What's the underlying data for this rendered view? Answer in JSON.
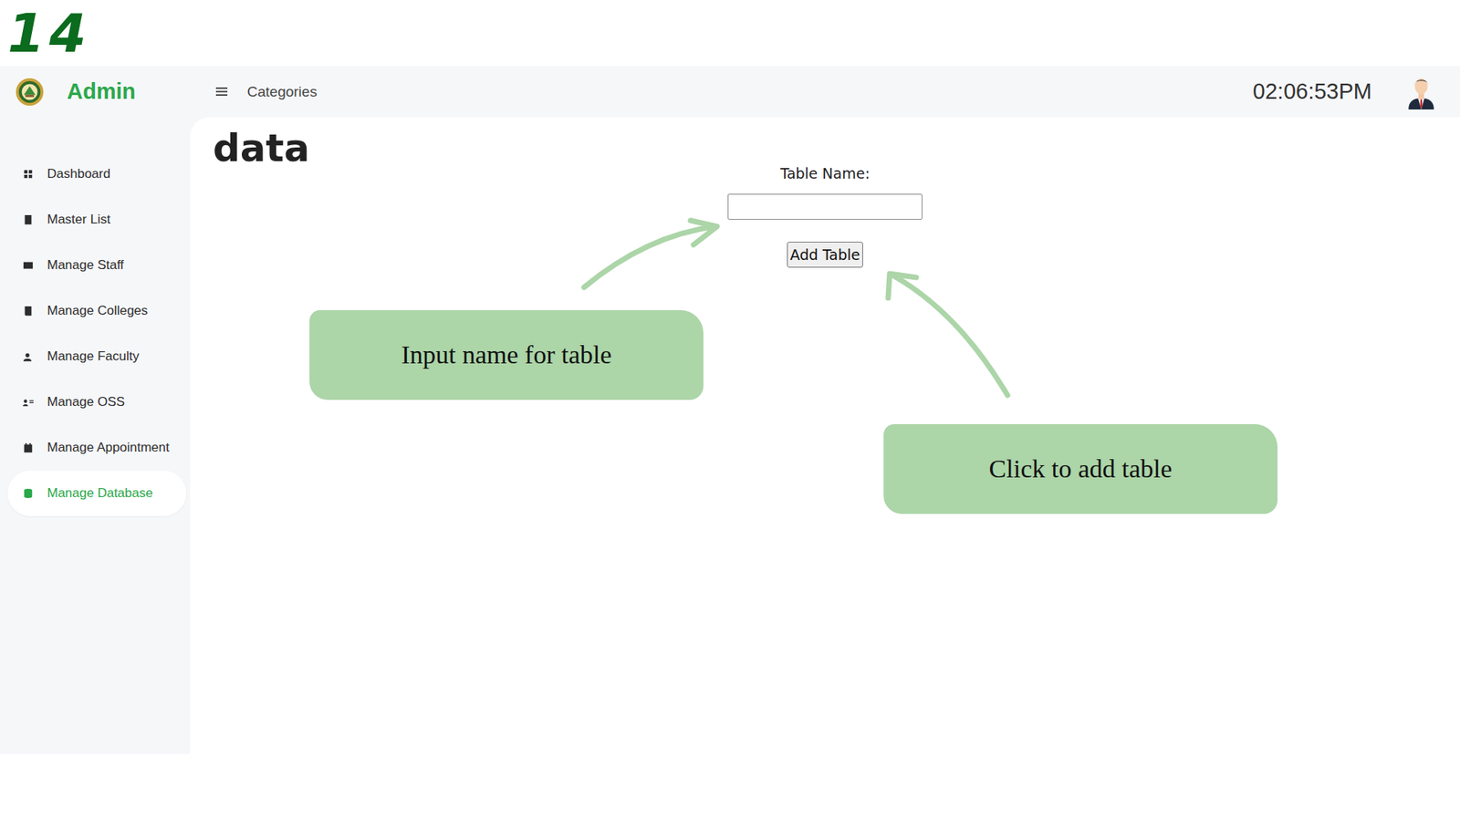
{
  "step": "14",
  "sidebar": {
    "brand": "Admin",
    "items": [
      {
        "label": "Dashboard",
        "selected": false
      },
      {
        "label": "Master List",
        "selected": false
      },
      {
        "label": "Manage Staff",
        "selected": false
      },
      {
        "label": "Manage Colleges",
        "selected": false
      },
      {
        "label": "Manage Faculty",
        "selected": false
      },
      {
        "label": "Manage OSS",
        "selected": false
      },
      {
        "label": "Manage Appointment",
        "selected": false
      },
      {
        "label": "Manage Database",
        "selected": true
      }
    ]
  },
  "header": {
    "title": "Categories",
    "time": "02:06:53PM"
  },
  "page": {
    "title": "data"
  },
  "form": {
    "label": "Table Name:",
    "value": "",
    "button": "Add Table"
  },
  "annotations": [
    {
      "text": "Input name for table"
    },
    {
      "text": "Click to add table"
    }
  ]
}
